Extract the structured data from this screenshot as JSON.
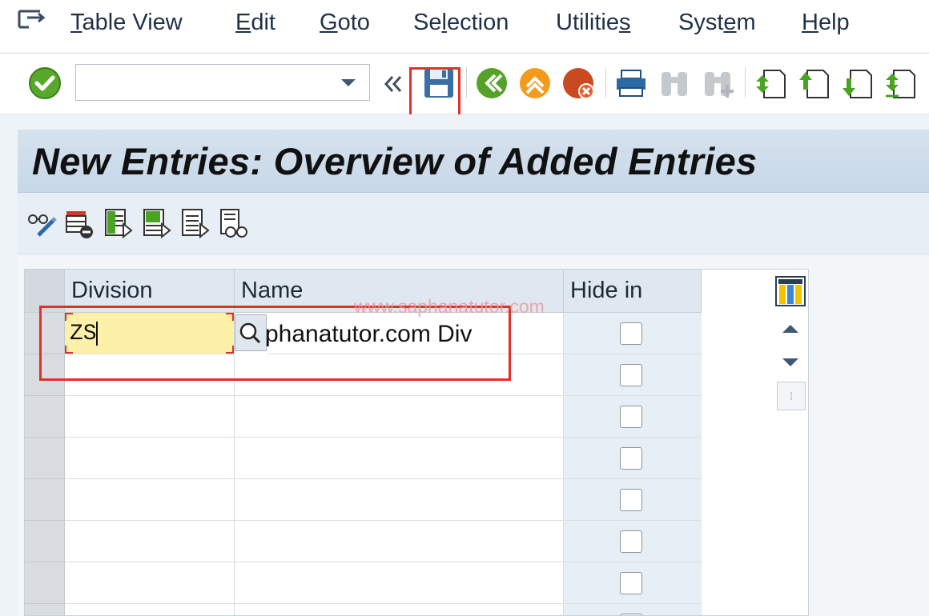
{
  "menu": {
    "items": [
      {
        "label": "Table View",
        "mnemonic_index": 0
      },
      {
        "label": "Edit",
        "mnemonic_index": 0
      },
      {
        "label": "Goto",
        "mnemonic_index": 0
      },
      {
        "label": "Selection",
        "mnemonic_index": 2
      },
      {
        "label": "Utilities",
        "mnemonic_index": 8
      },
      {
        "label": "System",
        "mnemonic_index": 4
      },
      {
        "label": "Help",
        "mnemonic_index": 0
      }
    ]
  },
  "toolbar": {
    "command_field": {
      "value": "",
      "placeholder": ""
    },
    "icons": [
      "enter-icon",
      "collapse-icon",
      "save-icon",
      "back-icon",
      "exit-icon",
      "cancel-icon",
      "print-icon",
      "find-icon",
      "find-next-icon",
      "first-page-icon",
      "previous-page-icon",
      "next-page-icon",
      "last-page-icon"
    ]
  },
  "page": {
    "title": "New Entries: Overview of Added Entries"
  },
  "app_toolbar": {
    "icons": [
      "display-change-icon",
      "delete-icon",
      "select-all-icon",
      "select-block-icon",
      "deselect-all-icon",
      "print-field-icon"
    ]
  },
  "table": {
    "columns": [
      "Division",
      "Name",
      "Hide in"
    ],
    "rows": [
      {
        "division": "ZS",
        "name": "phanatutor.com Div",
        "hide": false
      },
      {
        "division": "",
        "name": "",
        "hide": false
      },
      {
        "division": "",
        "name": "",
        "hide": false
      },
      {
        "division": "",
        "name": "",
        "hide": false
      },
      {
        "division": "",
        "name": "",
        "hide": false
      },
      {
        "division": "",
        "name": "",
        "hide": false
      },
      {
        "division": "",
        "name": "",
        "hide": false
      },
      {
        "division": "",
        "name": "",
        "hide": false
      }
    ]
  },
  "watermark": "www.saphanatutor.com",
  "colors": {
    "highlight": "#e0302a",
    "input_active": "#fdf0a8",
    "title_bar": "#cfdcea"
  }
}
